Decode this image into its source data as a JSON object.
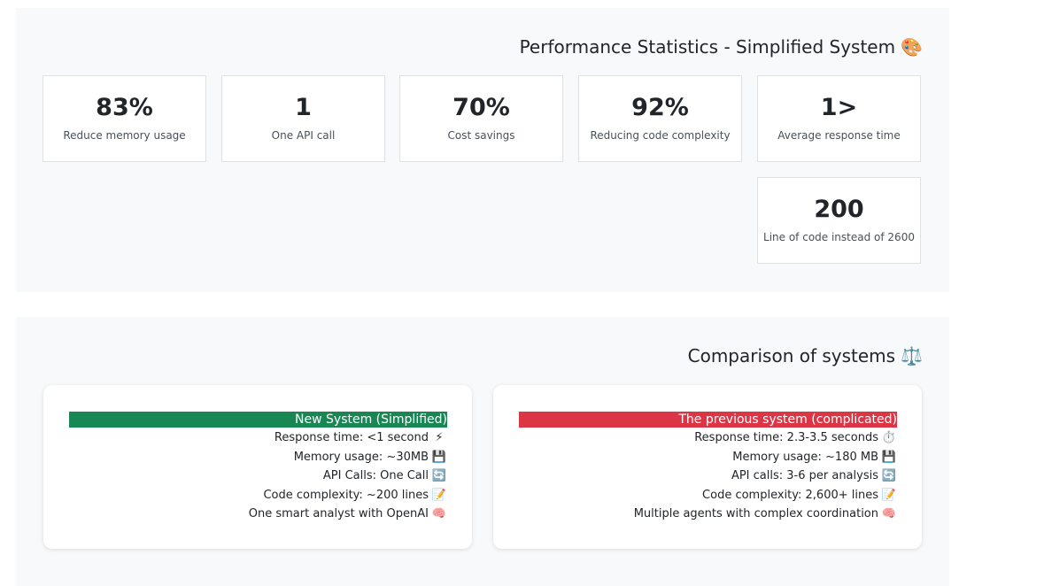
{
  "stats_section": {
    "title": "Performance Statistics - Simplified System",
    "title_icon": "🎨",
    "cards": [
      {
        "value": "83%",
        "label": "Reduce memory usage"
      },
      {
        "value": "1",
        "label": "One API call"
      },
      {
        "value": "70%",
        "label": "Cost savings"
      },
      {
        "value": "92%",
        "label": "Reducing code complexity"
      },
      {
        "value": "1>",
        "label": "Average response time"
      },
      {
        "value": "200",
        "label": "Line of code instead of 2600"
      }
    ]
  },
  "comparison_section": {
    "title": "Comparison of systems",
    "title_icon": "⚖️",
    "new_system": {
      "header": "New System (Simplified)",
      "header_color": "#198754",
      "items": [
        {
          "text": "Response time: <1 second",
          "icon": "⚡"
        },
        {
          "text": "Memory usage: ~30MB",
          "icon": "💾"
        },
        {
          "text": "API Calls: One Call",
          "icon": "🔄"
        },
        {
          "text": "Code complexity: ~200 lines",
          "icon": "📝"
        },
        {
          "text": "One smart analyst with OpenAI",
          "icon": "🧠"
        }
      ]
    },
    "old_system": {
      "header": "The previous system (complicated)",
      "header_color": "#dc3545",
      "items": [
        {
          "text": "Response time: 2.3-3.5 seconds",
          "icon": "⏱️"
        },
        {
          "text": "Memory usage: ~180 MB",
          "icon": "💾"
        },
        {
          "text": "API calls: 3-6 per analysis",
          "icon": "🔄"
        },
        {
          "text": "Code complexity: 2,600+ lines",
          "icon": "📝"
        },
        {
          "text": "Multiple agents with complex coordination",
          "icon": "🧠"
        }
      ]
    }
  }
}
